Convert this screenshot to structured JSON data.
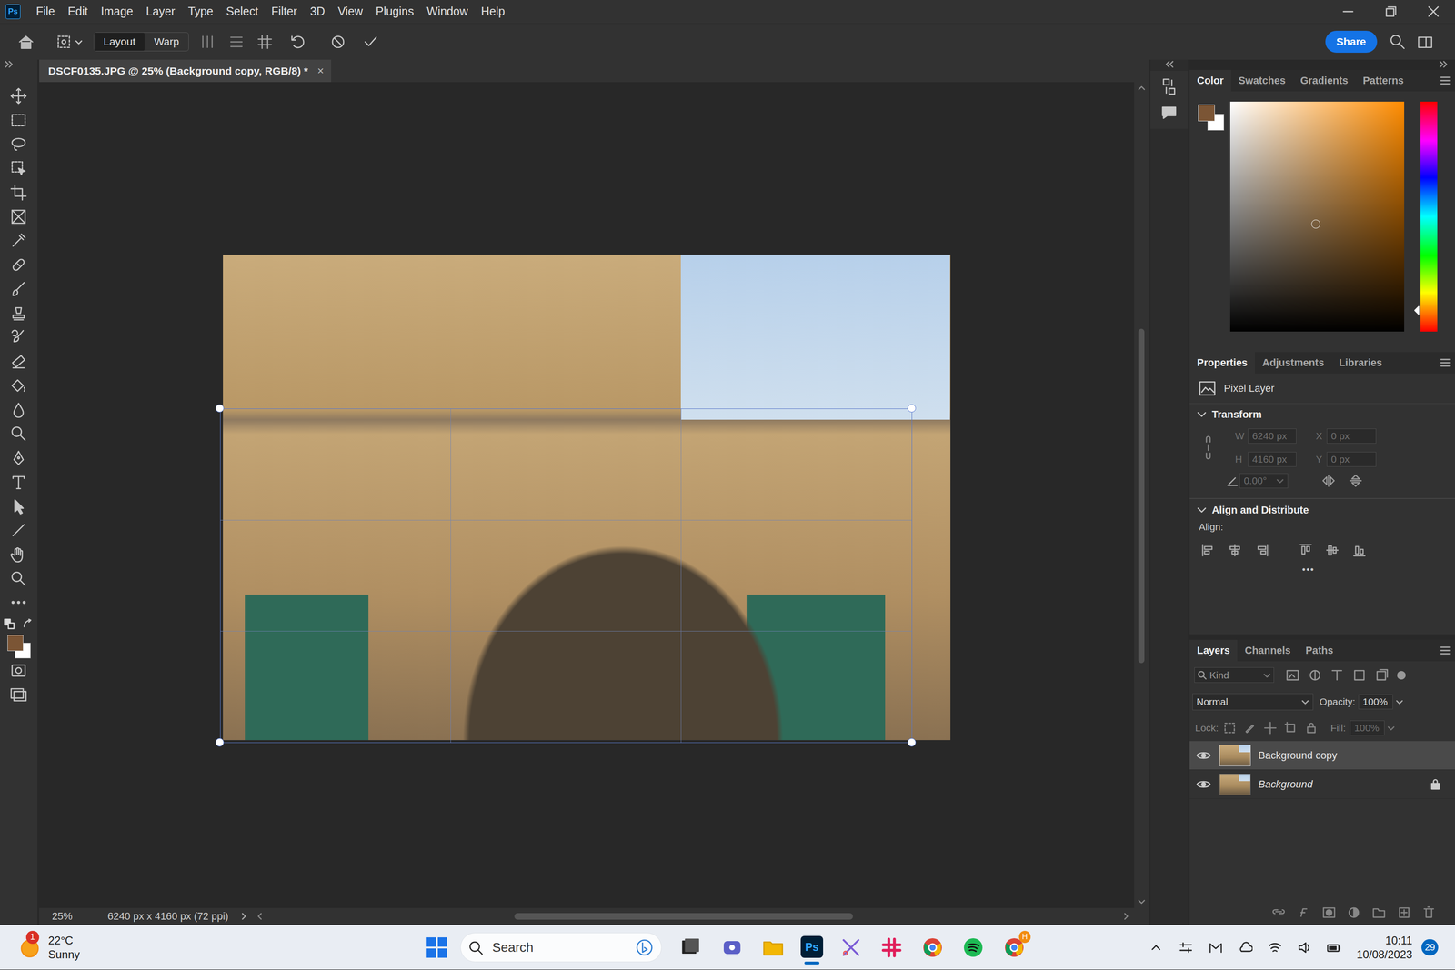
{
  "app": {
    "logo": "Ps"
  },
  "menu": [
    "File",
    "Edit",
    "Image",
    "Layer",
    "Type",
    "Select",
    "Filter",
    "3D",
    "View",
    "Plugins",
    "Window",
    "Help"
  ],
  "options_bar": {
    "modes": [
      {
        "label": "Layout",
        "selected": true
      },
      {
        "label": "Warp",
        "selected": false
      }
    ],
    "share": "Share"
  },
  "document": {
    "tab_title": "DSCF0135.JPG @ 25% (Background copy, RGB/8) *",
    "close": "×"
  },
  "status_bar": {
    "zoom": "25%",
    "info": "6240 px x 4160 px (72 ppi)"
  },
  "color_panel": {
    "tabs": [
      {
        "label": "Color",
        "selected": true
      },
      {
        "label": "Swatches",
        "selected": false
      },
      {
        "label": "Gradients",
        "selected": false
      },
      {
        "label": "Patterns",
        "selected": false
      }
    ]
  },
  "properties_panel": {
    "tabs": [
      {
        "label": "Properties",
        "selected": true
      },
      {
        "label": "Adjustments",
        "selected": false
      },
      {
        "label": "Libraries",
        "selected": false
      }
    ],
    "layer_kind": "Pixel Layer",
    "transform": {
      "title": "Transform",
      "w_label": "W",
      "w": "6240 px",
      "x_label": "X",
      "x": "0 px",
      "h_label": "H",
      "h": "4160 px",
      "y_label": "Y",
      "y": "0 px",
      "angle": "0.00°",
      "disabled": true
    },
    "align": {
      "title": "Align and Distribute",
      "label": "Align:",
      "more": "•••"
    }
  },
  "layers_panel": {
    "tabs": [
      {
        "label": "Layers",
        "selected": true
      },
      {
        "label": "Channels",
        "selected": false
      },
      {
        "label": "Paths",
        "selected": false
      }
    ],
    "filter": "Kind",
    "blend_mode": "Normal",
    "opacity_label": "Opacity:",
    "opacity": "100%",
    "lock_label": "Lock:",
    "fill_label": "Fill:",
    "fill": "100%",
    "fill_disabled": true,
    "layers": [
      {
        "name": "Background copy",
        "visible": true,
        "selected": true,
        "locked": false
      },
      {
        "name": "Background",
        "visible": true,
        "selected": false,
        "locked": true
      }
    ]
  },
  "taskbar": {
    "weather": {
      "temp": "22°C",
      "condition": "Sunny",
      "badge": "1"
    },
    "search": "Search",
    "chrome_badge": "H",
    "time": "10:11",
    "date": "10/08/2023",
    "notifications": "29"
  }
}
